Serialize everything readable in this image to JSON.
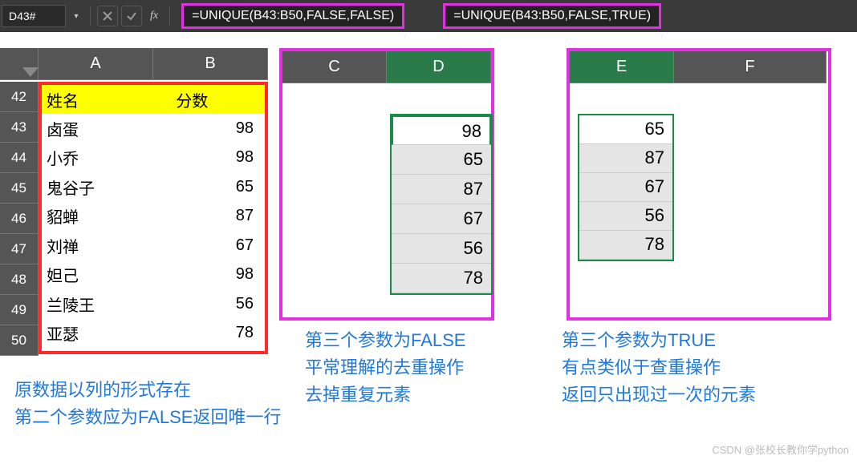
{
  "name_box": "D43#",
  "formula1": "=UNIQUE(B43:B50,FALSE,FALSE)",
  "formula2": "=UNIQUE(B43:B50,FALSE,TRUE)",
  "cols": {
    "A": "A",
    "B": "B",
    "C": "C",
    "D": "D",
    "E": "E",
    "F": "F"
  },
  "rows": [
    "42",
    "43",
    "44",
    "45",
    "46",
    "47",
    "48",
    "49",
    "50"
  ],
  "source": {
    "header_name": "姓名",
    "header_score": "分数",
    "data": [
      {
        "name": "卤蛋",
        "score": "98"
      },
      {
        "name": "小乔",
        "score": "98"
      },
      {
        "name": "鬼谷子",
        "score": "65"
      },
      {
        "name": "貂蝉",
        "score": "87"
      },
      {
        "name": "刘禅",
        "score": "67"
      },
      {
        "name": "妲己",
        "score": "98"
      },
      {
        "name": "兰陵王",
        "score": "56"
      },
      {
        "name": "亚瑟",
        "score": "78"
      }
    ]
  },
  "result1": [
    "98",
    "65",
    "87",
    "67",
    "56",
    "78"
  ],
  "result2": [
    "65",
    "87",
    "67",
    "56",
    "78"
  ],
  "ann1_l1": "原数据以列的形式存在",
  "ann1_l2": "第二个参数应为FALSE返回唯一行",
  "ann2_l1": "第三个参数为FALSE",
  "ann2_l2": "平常理解的去重操作",
  "ann2_l3": "去掉重复元素",
  "ann3_l1": "第三个参数为TRUE",
  "ann3_l2": "有点类似于查重操作",
  "ann3_l3": "返回只出现过一次的元素",
  "watermark": "CSDN @张校长教你学python",
  "chart_data": {
    "type": "table",
    "title": "UNIQUE function third-argument comparison",
    "source_columns": [
      "姓名",
      "分数"
    ],
    "source_rows": [
      [
        "卤蛋",
        98
      ],
      [
        "小乔",
        98
      ],
      [
        "鬼谷子",
        65
      ],
      [
        "貂蝉",
        87
      ],
      [
        "刘禅",
        67
      ],
      [
        "妲己",
        98
      ],
      [
        "兰陵王",
        56
      ],
      [
        "亚瑟",
        78
      ]
    ],
    "unique_false": [
      98,
      65,
      87,
      67,
      56,
      78
    ],
    "unique_true": [
      65,
      87,
      67,
      56,
      78
    ]
  }
}
